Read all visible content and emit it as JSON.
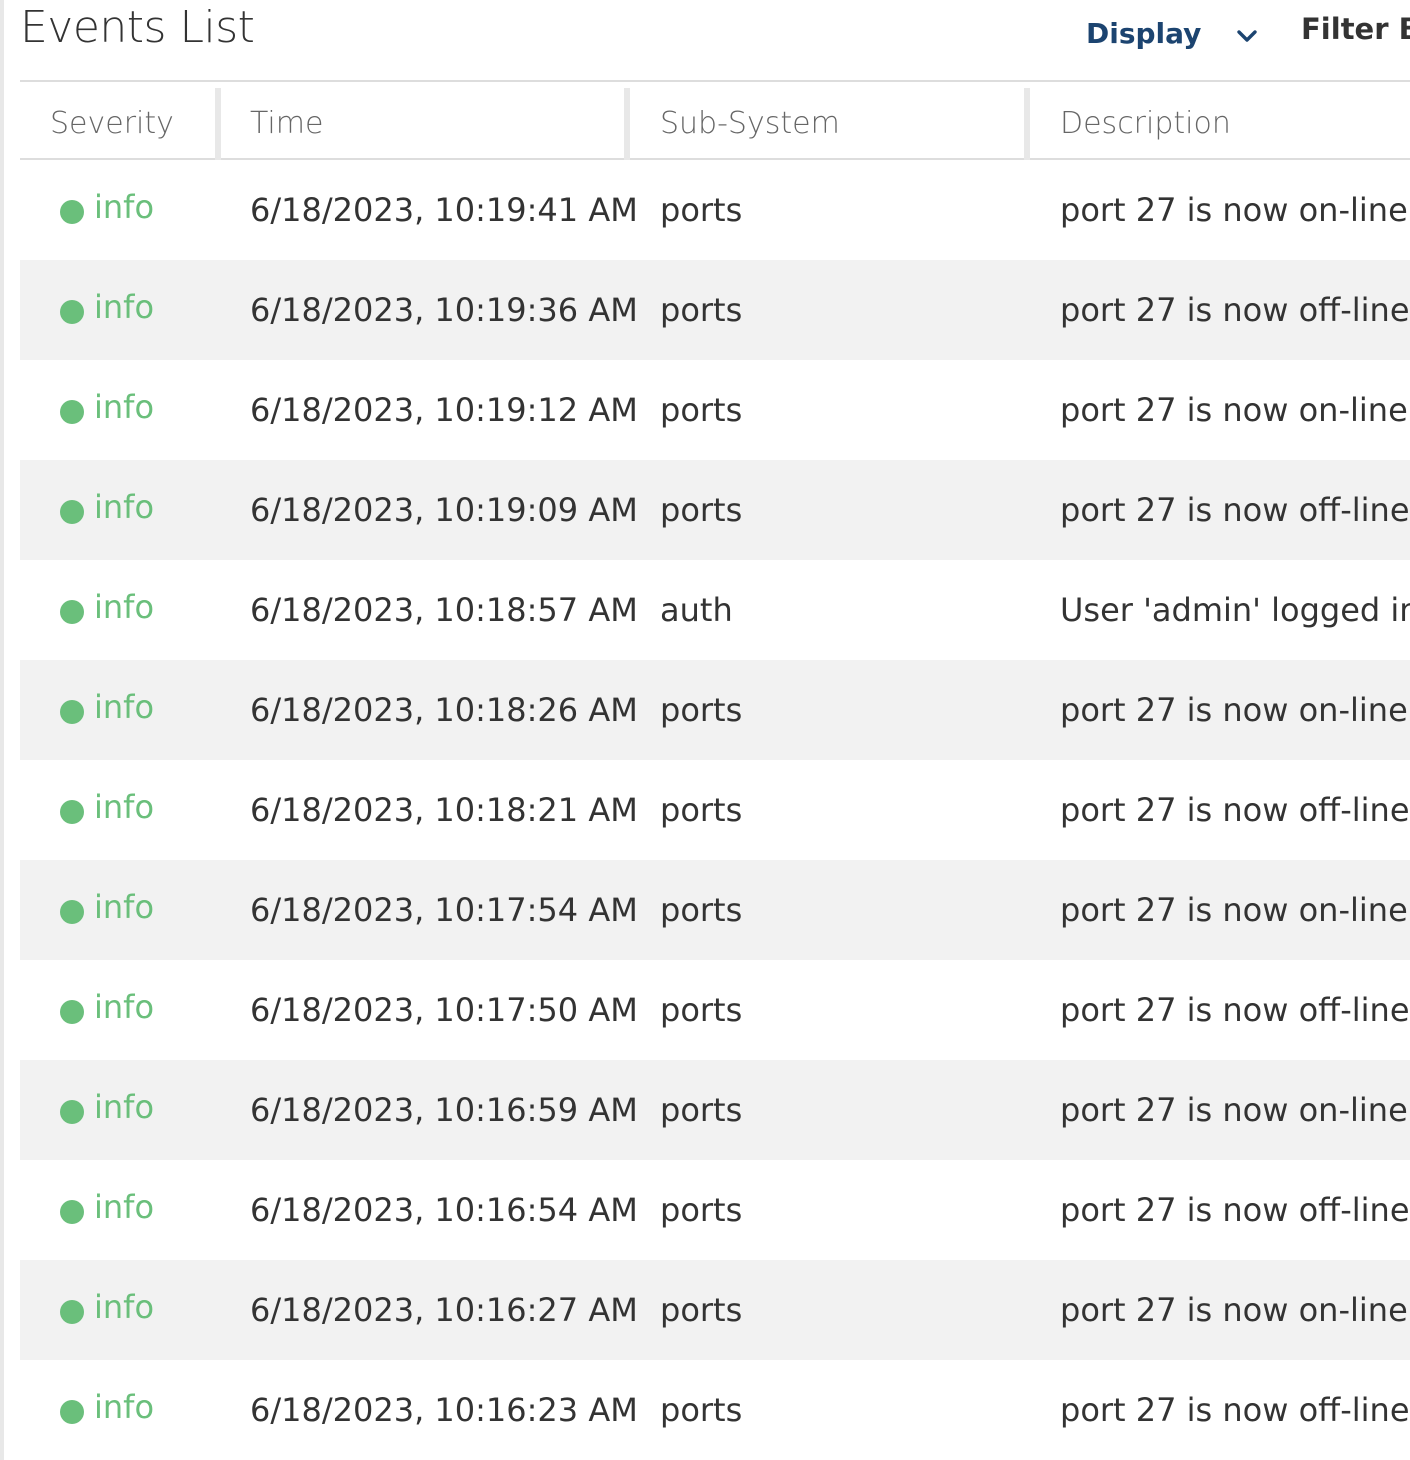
{
  "header": {
    "title": "Events List",
    "display_label": "Display",
    "filter_label": "Filter By"
  },
  "table": {
    "columns": {
      "severity": "Severity",
      "time": "Time",
      "subsystem": "Sub-System",
      "description": "Description"
    },
    "rows": [
      {
        "severity": "info",
        "time": "6/18/2023, 10:19:41 AM",
        "subsystem": "ports",
        "description": "port 27 is now on-line"
      },
      {
        "severity": "info",
        "time": "6/18/2023, 10:19:36 AM",
        "subsystem": "ports",
        "description": "port 27 is now off-line"
      },
      {
        "severity": "info",
        "time": "6/18/2023, 10:19:12 AM",
        "subsystem": "ports",
        "description": "port 27 is now on-line"
      },
      {
        "severity": "info",
        "time": "6/18/2023, 10:19:09 AM",
        "subsystem": "ports",
        "description": "port 27 is now off-line"
      },
      {
        "severity": "info",
        "time": "6/18/2023, 10:18:57 AM",
        "subsystem": "auth",
        "description": "User 'admin' logged in f"
      },
      {
        "severity": "info",
        "time": "6/18/2023, 10:18:26 AM",
        "subsystem": "ports",
        "description": "port 27 is now on-line"
      },
      {
        "severity": "info",
        "time": "6/18/2023, 10:18:21 AM",
        "subsystem": "ports",
        "description": "port 27 is now off-line"
      },
      {
        "severity": "info",
        "time": "6/18/2023, 10:17:54 AM",
        "subsystem": "ports",
        "description": "port 27 is now on-line"
      },
      {
        "severity": "info",
        "time": "6/18/2023, 10:17:50 AM",
        "subsystem": "ports",
        "description": "port 27 is now off-line"
      },
      {
        "severity": "info",
        "time": "6/18/2023, 10:16:59 AM",
        "subsystem": "ports",
        "description": "port 27 is now on-line"
      },
      {
        "severity": "info",
        "time": "6/18/2023, 10:16:54 AM",
        "subsystem": "ports",
        "description": "port 27 is now off-line"
      },
      {
        "severity": "info",
        "time": "6/18/2023, 10:16:27 AM",
        "subsystem": "ports",
        "description": "port 27 is now on-line"
      },
      {
        "severity": "info",
        "time": "6/18/2023, 10:16:23 AM",
        "subsystem": "ports",
        "description": "port 27 is now off-line"
      }
    ]
  },
  "icons": {
    "display_toggle": "chevron-down-icon",
    "severity_marker": "status-dot-icon"
  },
  "colors": {
    "accent": "#1c4470",
    "info": "#6abf7b",
    "stripe": "#f2f2f2"
  }
}
